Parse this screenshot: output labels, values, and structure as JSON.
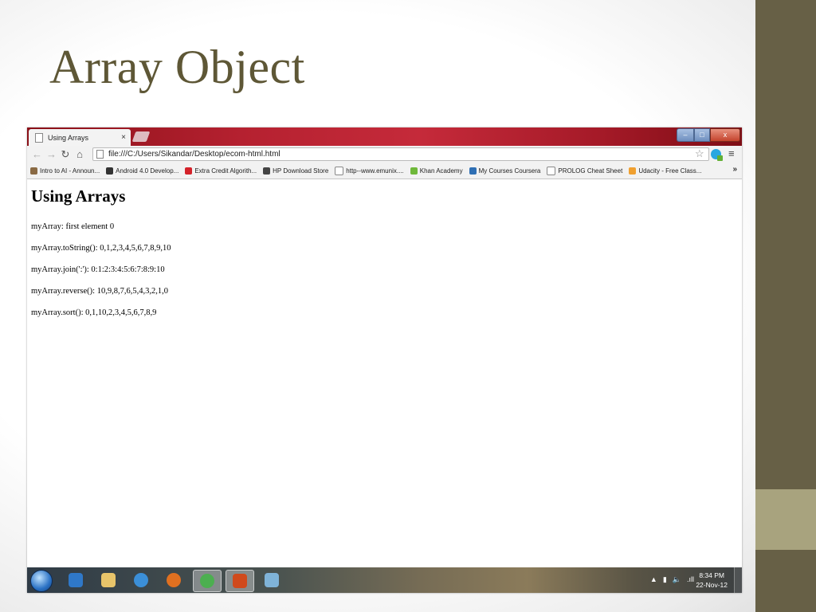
{
  "slide": {
    "title": "Array Object"
  },
  "browser": {
    "tab_title": "Using Arrays",
    "tab_close": "×",
    "address": "file:///C:/Users/Sikandar/Desktop/ecom-html.html",
    "nav_icons": [
      "back-arrow-icon",
      "forward-arrow-icon",
      "reload-icon",
      "home-icon"
    ],
    "bookmarks": [
      {
        "label": "Intro to AI - Announ...",
        "icon": "ai-class-icon",
        "color": "#8a6a44"
      },
      {
        "label": "Android 4.0 Develop...",
        "icon": "android-icon",
        "color": "#333333"
      },
      {
        "label": "Extra Credit Algorith...",
        "icon": "udacity-red-icon",
        "color": "#d4222a"
      },
      {
        "label": "HP Download Store",
        "icon": "hp-icon",
        "color": "#444444"
      },
      {
        "label": "http--www.emunix....",
        "icon": "page-icon",
        "color": "#ffffff"
      },
      {
        "label": "Khan Academy",
        "icon": "leaf-icon",
        "color": "#6fb83a"
      },
      {
        "label": "My Courses Coursera",
        "icon": "coursera-icon",
        "color": "#2f6fb4"
      },
      {
        "label": "PROLOG Cheat Sheet",
        "icon": "page-icon",
        "color": "#ffffff"
      },
      {
        "label": "Udacity - Free Class...",
        "icon": "udacity-icon",
        "color": "#f0a030"
      }
    ],
    "bookmarks_more": "»"
  },
  "page": {
    "heading": "Using Arrays",
    "lines": [
      "myArray: first element 0",
      "myArray.toString(): 0,1,2,3,4,5,6,7,8,9,10",
      "myArray.join(':'): 0:1:2:3:4:5:6:7:8:9:10",
      "myArray.reverse(): 10,9,8,7,6,5,4,3,2,1,0",
      "myArray.sort(): 0,1,10,2,3,4,5,6,7,8,9"
    ]
  },
  "taskbar": {
    "apps": [
      {
        "name": "media-player-icon",
        "color": "#2f78c8"
      },
      {
        "name": "explorer-folder-icon",
        "color": "#e8c46a"
      },
      {
        "name": "internet-explorer-icon",
        "color": "#3b8fd8"
      },
      {
        "name": "firefox-icon",
        "color": "#e07020"
      },
      {
        "name": "chrome-icon",
        "color": "#4caf50",
        "active": true
      },
      {
        "name": "powerpoint-icon",
        "color": "#d04a1c",
        "active": true
      },
      {
        "name": "notepad-icon",
        "color": "#7fb3d8"
      }
    ],
    "time": "8:34 PM",
    "date": "22-Nov-12"
  },
  "colors": {
    "title_text": "#5e5736",
    "side_bar": "#676046",
    "side_accent": "#a8a37e",
    "chrome_frame": "#b52130"
  }
}
